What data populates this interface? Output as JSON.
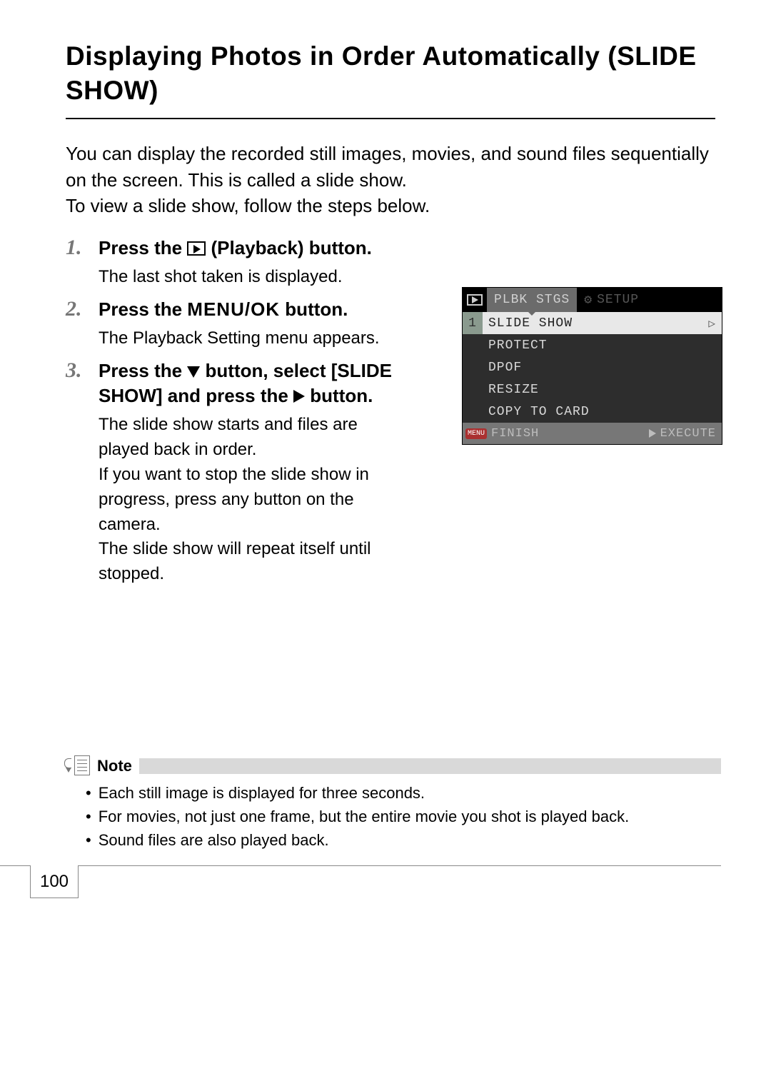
{
  "title": "Displaying Photos in Order Automatically (SLIDE SHOW)",
  "intro": "You can display the recorded still images, movies, and sound files sequentially on the screen. This is called a slide show.\nTo view a slide show, follow the steps below.",
  "steps": {
    "s1": {
      "num": "1.",
      "pre": "Press the ",
      "post": " (Playback) button.",
      "desc": "The last shot taken is displayed."
    },
    "s2": {
      "num": "2.",
      "pre": "Press the ",
      "menuok": "MENU/OK",
      "post": " button.",
      "desc": "The Playback Setting menu appears."
    },
    "s3": {
      "num": "3.",
      "part_a": "Press the ",
      "part_b": " button, select [SLIDE SHOW] and press the ",
      "part_c": " button.",
      "desc": "The slide show starts and files are played back in order.\nIf you want to stop the slide show in progress, press any button on the camera.\nThe slide show will repeat itself until stopped."
    }
  },
  "screenshot": {
    "tab_active": "PLBK STGS",
    "tab_other": "SETUP",
    "sel_num": "1",
    "items": {
      "i1": "SLIDE SHOW",
      "i2": "PROTECT",
      "i3": "DPOF",
      "i4": "RESIZE",
      "i5": "COPY TO CARD"
    },
    "footer_badge": "MENU",
    "footer_left": "FINISH",
    "footer_right": "EXECUTE"
  },
  "note": {
    "label": "Note",
    "items": {
      "n1": "Each still image is displayed for three seconds.",
      "n2": "For movies, not just one frame, but the entire movie you shot is played back.",
      "n3": "Sound files are also played back."
    }
  },
  "page_number": "100"
}
